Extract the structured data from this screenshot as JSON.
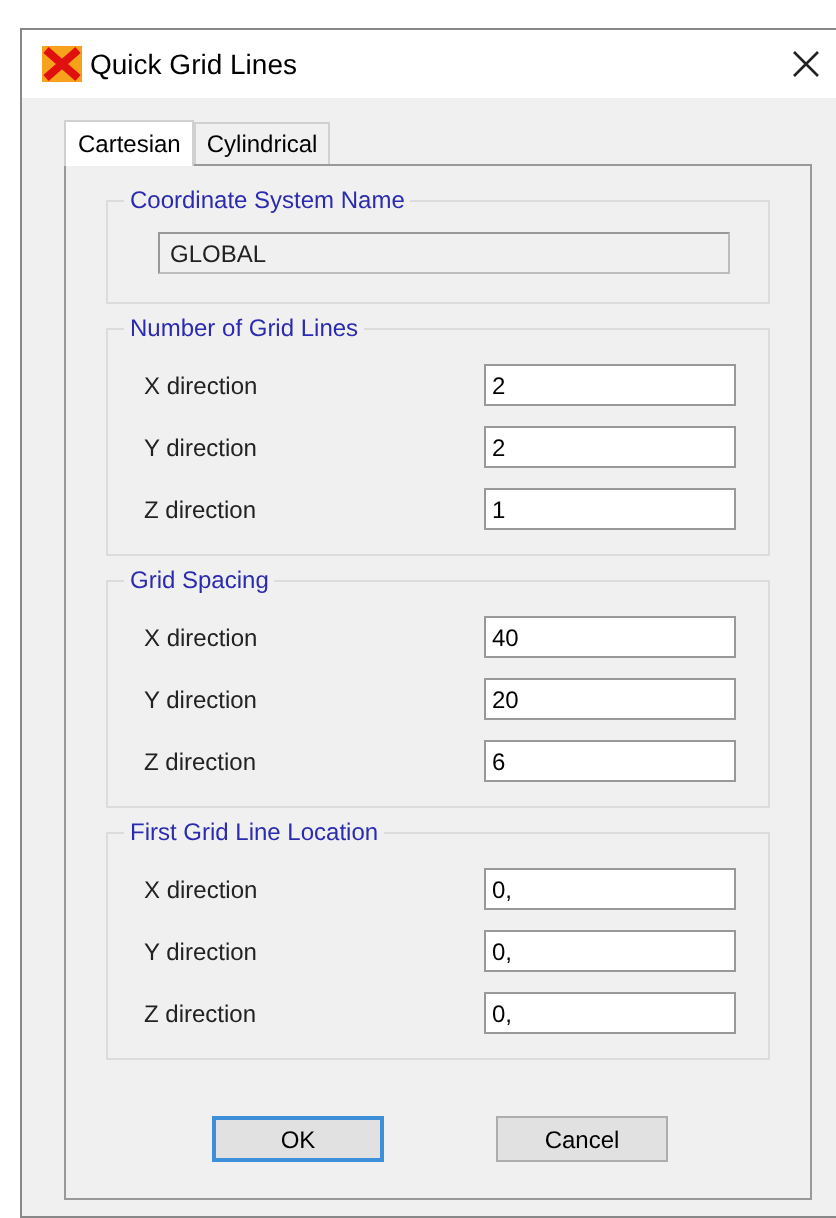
{
  "window": {
    "title": "Quick Grid Lines"
  },
  "tabs": [
    {
      "label": "Cartesian",
      "selected": true
    },
    {
      "label": "Cylindrical",
      "selected": false
    }
  ],
  "coordinate_system": {
    "title": "Coordinate System Name",
    "value": "GLOBAL"
  },
  "groups": [
    {
      "title": "Number of Grid Lines",
      "fields": [
        {
          "label": "X direction",
          "value": "2"
        },
        {
          "label": "Y direction",
          "value": "2"
        },
        {
          "label": "Z direction",
          "value": "1"
        }
      ]
    },
    {
      "title": "Grid Spacing",
      "fields": [
        {
          "label": "X direction",
          "value": "40"
        },
        {
          "label": "Y direction",
          "value": "20"
        },
        {
          "label": "Z direction",
          "value": "6"
        }
      ]
    },
    {
      "title": "First Grid Line Location",
      "fields": [
        {
          "label": "X direction",
          "value": "0,"
        },
        {
          "label": "Y direction",
          "value": "0,"
        },
        {
          "label": "Z direction",
          "value": "0,"
        }
      ]
    }
  ],
  "buttons": [
    {
      "label": "OK",
      "default": true
    },
    {
      "label": "Cancel",
      "default": false
    }
  ]
}
